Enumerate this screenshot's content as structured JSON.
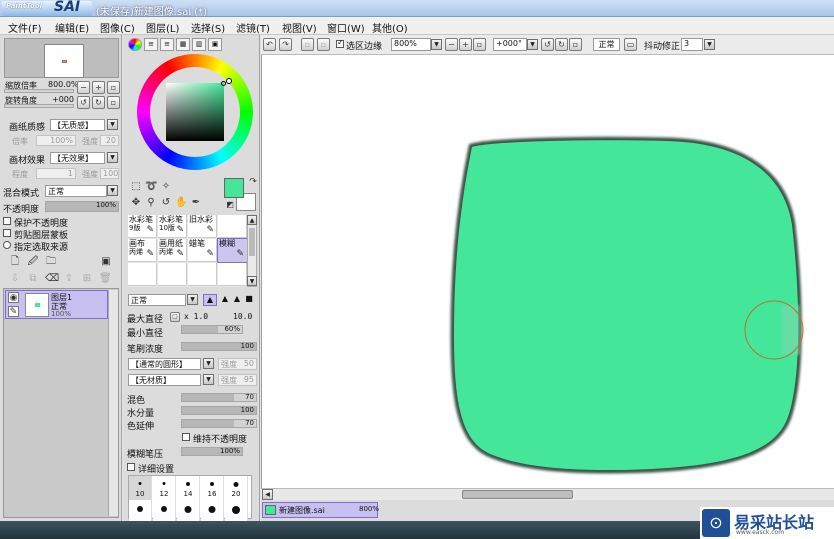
{
  "window": {
    "logo_small": "PaintTool",
    "logo_big": "SAI",
    "title": "(未保存)新建图像.sai (*)"
  },
  "menus": [
    "文件(F)",
    "编辑(E)",
    "图像(C)",
    "图层(L)",
    "选择(S)",
    "滤镜(T)",
    "视图(V)",
    "窗口(W)",
    "其他(O)"
  ],
  "navigator": {
    "zoom_label": "缩放倍率",
    "zoom_value": "800.0%",
    "angle_label": "旋转角度",
    "angle_value": "+000"
  },
  "paper": {
    "texture_label": "画纸质感",
    "texture_value": "【无质感】",
    "scale_label": "倍率",
    "scale_value": "100%",
    "strength_label": "强度",
    "strength_value": "20",
    "effect_label": "画材效果",
    "effect_value": "【无效果】",
    "degree_label": "程度",
    "degree_value": "1",
    "effect_strength_label": "强度",
    "effect_strength_value": "100"
  },
  "layer_props": {
    "blend_label": "混合模式",
    "blend_value": "正常",
    "opacity_label": "不透明度",
    "opacity_value": "100%",
    "opacity_fraction": 1.0,
    "protect_alpha": "保护不透明度",
    "clip_group": "剪贴图层蒙板",
    "selection_source": "指定选取来源"
  },
  "layers": [
    {
      "name": "图层1",
      "mode": "正常",
      "opacity": "100%"
    }
  ],
  "brushes": [
    {
      "name": "水彩笔",
      "size": "9版"
    },
    {
      "name": "水彩笔",
      "size": "10版"
    },
    {
      "name": "旧水彩",
      "size": ""
    },
    {
      "name": "",
      "size": ""
    },
    {
      "name": "画布",
      "size": "丙烯"
    },
    {
      "name": "画用纸",
      "size": "丙烯"
    },
    {
      "name": "蜡笔",
      "size": ""
    },
    {
      "name": "模糊",
      "size": ""
    }
  ],
  "brush_settings": {
    "mode": "正常",
    "max_diameter_label": "最大直径",
    "max_diameter_mult": "x 1.0",
    "max_diameter_value": "10.0",
    "min_diameter_label": "最小直径",
    "min_diameter_value": "60%",
    "min_diameter_fraction": 0.6,
    "density_label": "笔刷浓度",
    "density_value": "100",
    "density_fraction": 1.0,
    "shape_value": "【通常的圆形】",
    "shape_strength_label": "强度",
    "shape_strength_value": "50",
    "texture_value": "【无材质】",
    "texture_strength_label": "强度",
    "texture_strength_value": "95",
    "blend_label": "混色",
    "blend_value": "70",
    "blend_fraction": 0.7,
    "water_label": "水分量",
    "water_value": "100",
    "water_fraction": 1.0,
    "persist_label": "色延伸",
    "persist_value": "70",
    "persist_fraction": 0.7,
    "keep_opacity": "维持不透明度",
    "blur_pressure_label": "模糊笔压",
    "blur_pressure_value": "100%",
    "blur_pressure_fraction": 1.0,
    "detail_settings": "详细设置"
  },
  "brush_sizes": [
    "10",
    "12",
    "14",
    "16",
    "20"
  ],
  "canvas_toolbar": {
    "selection_edge": "选区边缘",
    "zoom": "800%",
    "angle": "+000°",
    "mode": "正常",
    "stabilizer_label": "抖动修正",
    "stabilizer_value": "3"
  },
  "doc_tab": {
    "name": "新建图像.sai",
    "zoom": "800%"
  },
  "colors": {
    "primary": "#44e69a",
    "selection": "#c7c0f0"
  },
  "watermark": {
    "text": "易采站长站",
    "url": "www.easck.com"
  }
}
